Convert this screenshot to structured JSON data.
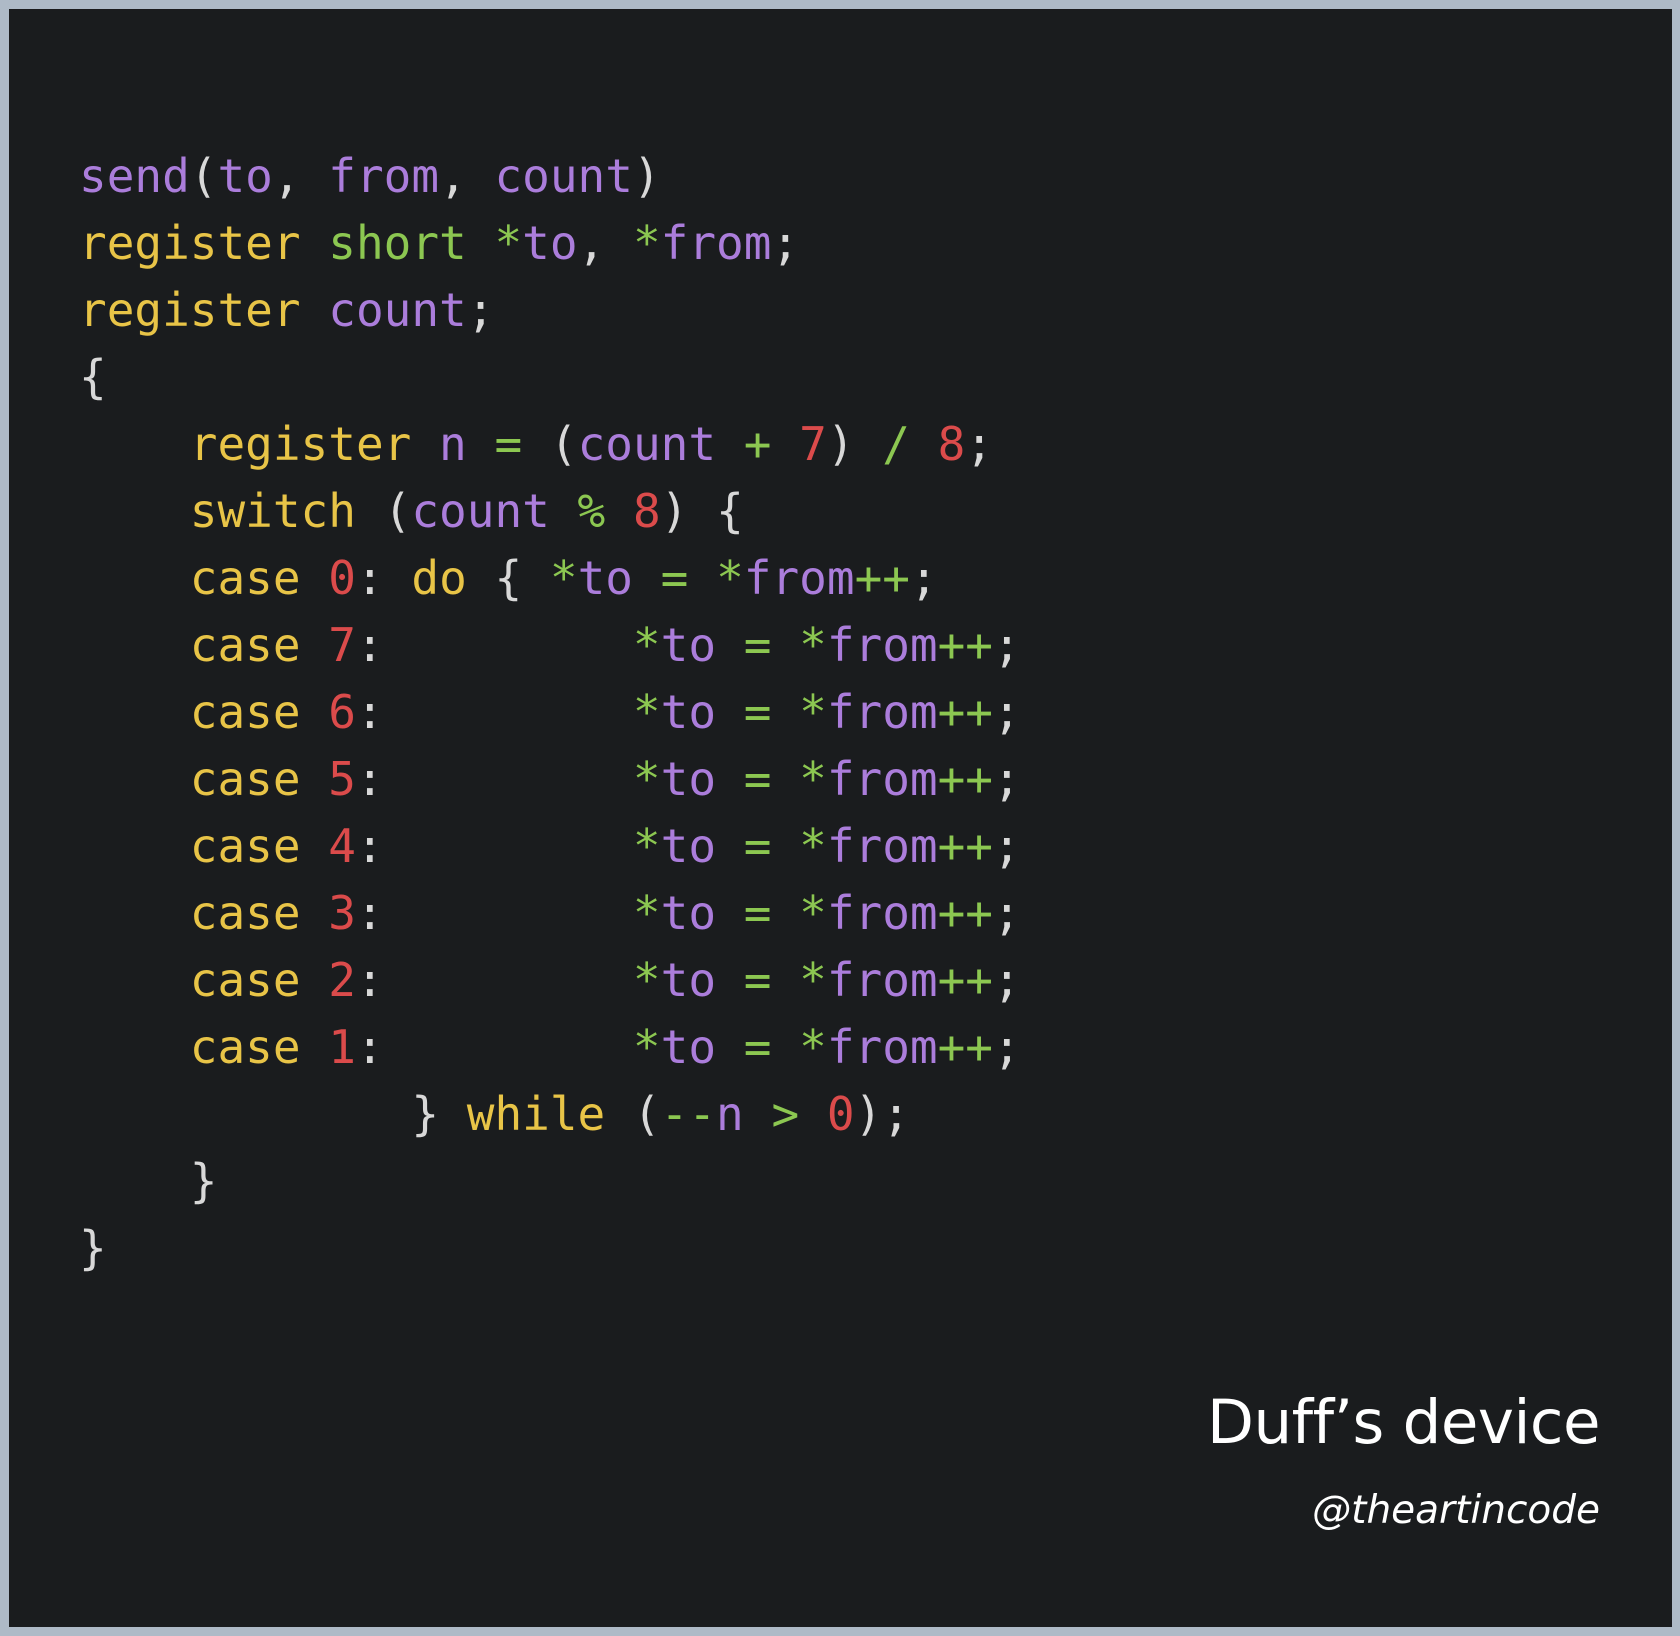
{
  "theme": {
    "border_color": "#aebac7",
    "code_background": "#1a1c1e",
    "keyword_color": "#e8c447",
    "type_color": "#8cc751",
    "identifier_color": "#ab7ddb",
    "operator_color": "#8cc751",
    "number_color": "#db4b4b",
    "punctuation_color": "#d8d8d8",
    "caption_color": "#ffffff"
  },
  "code": {
    "language": "c",
    "lines": [
      [
        {
          "t": "send",
          "c": "id"
        },
        {
          "t": "(",
          "c": "pun"
        },
        {
          "t": "to",
          "c": "id"
        },
        {
          "t": ",",
          "c": "pun"
        },
        {
          "t": " ",
          "c": "pun"
        },
        {
          "t": "from",
          "c": "id"
        },
        {
          "t": ",",
          "c": "pun"
        },
        {
          "t": " ",
          "c": "pun"
        },
        {
          "t": "count",
          "c": "id"
        },
        {
          "t": ")",
          "c": "pun"
        }
      ],
      [
        {
          "t": "register",
          "c": "kw"
        },
        {
          "t": " ",
          "c": "pun"
        },
        {
          "t": "short",
          "c": "typ"
        },
        {
          "t": " ",
          "c": "pun"
        },
        {
          "t": "*",
          "c": "op"
        },
        {
          "t": "to",
          "c": "id"
        },
        {
          "t": ",",
          "c": "pun"
        },
        {
          "t": " ",
          "c": "pun"
        },
        {
          "t": "*",
          "c": "op"
        },
        {
          "t": "from",
          "c": "id"
        },
        {
          "t": ";",
          "c": "pun"
        }
      ],
      [
        {
          "t": "register",
          "c": "kw"
        },
        {
          "t": " ",
          "c": "pun"
        },
        {
          "t": "count",
          "c": "id"
        },
        {
          "t": ";",
          "c": "pun"
        }
      ],
      [
        {
          "t": "{",
          "c": "pun"
        }
      ],
      [
        {
          "t": "    ",
          "c": "pun"
        },
        {
          "t": "register",
          "c": "kw"
        },
        {
          "t": " ",
          "c": "pun"
        },
        {
          "t": "n",
          "c": "id"
        },
        {
          "t": " ",
          "c": "pun"
        },
        {
          "t": "=",
          "c": "op"
        },
        {
          "t": " ",
          "c": "pun"
        },
        {
          "t": "(",
          "c": "pun"
        },
        {
          "t": "count",
          "c": "id"
        },
        {
          "t": " ",
          "c": "pun"
        },
        {
          "t": "+",
          "c": "op"
        },
        {
          "t": " ",
          "c": "pun"
        },
        {
          "t": "7",
          "c": "num"
        },
        {
          "t": ")",
          "c": "pun"
        },
        {
          "t": " ",
          "c": "pun"
        },
        {
          "t": "/",
          "c": "op"
        },
        {
          "t": " ",
          "c": "pun"
        },
        {
          "t": "8",
          "c": "num"
        },
        {
          "t": ";",
          "c": "pun"
        }
      ],
      [
        {
          "t": "    ",
          "c": "pun"
        },
        {
          "t": "switch",
          "c": "kw"
        },
        {
          "t": " ",
          "c": "pun"
        },
        {
          "t": "(",
          "c": "pun"
        },
        {
          "t": "count",
          "c": "id"
        },
        {
          "t": " ",
          "c": "pun"
        },
        {
          "t": "%",
          "c": "op"
        },
        {
          "t": " ",
          "c": "pun"
        },
        {
          "t": "8",
          "c": "num"
        },
        {
          "t": ")",
          "c": "pun"
        },
        {
          "t": " ",
          "c": "pun"
        },
        {
          "t": "{",
          "c": "pun"
        }
      ],
      [
        {
          "t": "    ",
          "c": "pun"
        },
        {
          "t": "case",
          "c": "kw"
        },
        {
          "t": " ",
          "c": "pun"
        },
        {
          "t": "0",
          "c": "num"
        },
        {
          "t": ":",
          "c": "pun"
        },
        {
          "t": " ",
          "c": "pun"
        },
        {
          "t": "do",
          "c": "kw"
        },
        {
          "t": " ",
          "c": "pun"
        },
        {
          "t": "{",
          "c": "pun"
        },
        {
          "t": " ",
          "c": "pun"
        },
        {
          "t": "*",
          "c": "op"
        },
        {
          "t": "to",
          "c": "id"
        },
        {
          "t": " ",
          "c": "pun"
        },
        {
          "t": "=",
          "c": "op"
        },
        {
          "t": " ",
          "c": "pun"
        },
        {
          "t": "*",
          "c": "op"
        },
        {
          "t": "from",
          "c": "id"
        },
        {
          "t": "++",
          "c": "op"
        },
        {
          "t": ";",
          "c": "pun"
        }
      ],
      [
        {
          "t": "    ",
          "c": "pun"
        },
        {
          "t": "case",
          "c": "kw"
        },
        {
          "t": " ",
          "c": "pun"
        },
        {
          "t": "7",
          "c": "num"
        },
        {
          "t": ":",
          "c": "pun"
        },
        {
          "t": "         ",
          "c": "pun"
        },
        {
          "t": "*",
          "c": "op"
        },
        {
          "t": "to",
          "c": "id"
        },
        {
          "t": " ",
          "c": "pun"
        },
        {
          "t": "=",
          "c": "op"
        },
        {
          "t": " ",
          "c": "pun"
        },
        {
          "t": "*",
          "c": "op"
        },
        {
          "t": "from",
          "c": "id"
        },
        {
          "t": "++",
          "c": "op"
        },
        {
          "t": ";",
          "c": "pun"
        }
      ],
      [
        {
          "t": "    ",
          "c": "pun"
        },
        {
          "t": "case",
          "c": "kw"
        },
        {
          "t": " ",
          "c": "pun"
        },
        {
          "t": "6",
          "c": "num"
        },
        {
          "t": ":",
          "c": "pun"
        },
        {
          "t": "         ",
          "c": "pun"
        },
        {
          "t": "*",
          "c": "op"
        },
        {
          "t": "to",
          "c": "id"
        },
        {
          "t": " ",
          "c": "pun"
        },
        {
          "t": "=",
          "c": "op"
        },
        {
          "t": " ",
          "c": "pun"
        },
        {
          "t": "*",
          "c": "op"
        },
        {
          "t": "from",
          "c": "id"
        },
        {
          "t": "++",
          "c": "op"
        },
        {
          "t": ";",
          "c": "pun"
        }
      ],
      [
        {
          "t": "    ",
          "c": "pun"
        },
        {
          "t": "case",
          "c": "kw"
        },
        {
          "t": " ",
          "c": "pun"
        },
        {
          "t": "5",
          "c": "num"
        },
        {
          "t": ":",
          "c": "pun"
        },
        {
          "t": "         ",
          "c": "pun"
        },
        {
          "t": "*",
          "c": "op"
        },
        {
          "t": "to",
          "c": "id"
        },
        {
          "t": " ",
          "c": "pun"
        },
        {
          "t": "=",
          "c": "op"
        },
        {
          "t": " ",
          "c": "pun"
        },
        {
          "t": "*",
          "c": "op"
        },
        {
          "t": "from",
          "c": "id"
        },
        {
          "t": "++",
          "c": "op"
        },
        {
          "t": ";",
          "c": "pun"
        }
      ],
      [
        {
          "t": "    ",
          "c": "pun"
        },
        {
          "t": "case",
          "c": "kw"
        },
        {
          "t": " ",
          "c": "pun"
        },
        {
          "t": "4",
          "c": "num"
        },
        {
          "t": ":",
          "c": "pun"
        },
        {
          "t": "         ",
          "c": "pun"
        },
        {
          "t": "*",
          "c": "op"
        },
        {
          "t": "to",
          "c": "id"
        },
        {
          "t": " ",
          "c": "pun"
        },
        {
          "t": "=",
          "c": "op"
        },
        {
          "t": " ",
          "c": "pun"
        },
        {
          "t": "*",
          "c": "op"
        },
        {
          "t": "from",
          "c": "id"
        },
        {
          "t": "++",
          "c": "op"
        },
        {
          "t": ";",
          "c": "pun"
        }
      ],
      [
        {
          "t": "    ",
          "c": "pun"
        },
        {
          "t": "case",
          "c": "kw"
        },
        {
          "t": " ",
          "c": "pun"
        },
        {
          "t": "3",
          "c": "num"
        },
        {
          "t": ":",
          "c": "pun"
        },
        {
          "t": "         ",
          "c": "pun"
        },
        {
          "t": "*",
          "c": "op"
        },
        {
          "t": "to",
          "c": "id"
        },
        {
          "t": " ",
          "c": "pun"
        },
        {
          "t": "=",
          "c": "op"
        },
        {
          "t": " ",
          "c": "pun"
        },
        {
          "t": "*",
          "c": "op"
        },
        {
          "t": "from",
          "c": "id"
        },
        {
          "t": "++",
          "c": "op"
        },
        {
          "t": ";",
          "c": "pun"
        }
      ],
      [
        {
          "t": "    ",
          "c": "pun"
        },
        {
          "t": "case",
          "c": "kw"
        },
        {
          "t": " ",
          "c": "pun"
        },
        {
          "t": "2",
          "c": "num"
        },
        {
          "t": ":",
          "c": "pun"
        },
        {
          "t": "         ",
          "c": "pun"
        },
        {
          "t": "*",
          "c": "op"
        },
        {
          "t": "to",
          "c": "id"
        },
        {
          "t": " ",
          "c": "pun"
        },
        {
          "t": "=",
          "c": "op"
        },
        {
          "t": " ",
          "c": "pun"
        },
        {
          "t": "*",
          "c": "op"
        },
        {
          "t": "from",
          "c": "id"
        },
        {
          "t": "++",
          "c": "op"
        },
        {
          "t": ";",
          "c": "pun"
        }
      ],
      [
        {
          "t": "    ",
          "c": "pun"
        },
        {
          "t": "case",
          "c": "kw"
        },
        {
          "t": " ",
          "c": "pun"
        },
        {
          "t": "1",
          "c": "num"
        },
        {
          "t": ":",
          "c": "pun"
        },
        {
          "t": "         ",
          "c": "pun"
        },
        {
          "t": "*",
          "c": "op"
        },
        {
          "t": "to",
          "c": "id"
        },
        {
          "t": " ",
          "c": "pun"
        },
        {
          "t": "=",
          "c": "op"
        },
        {
          "t": " ",
          "c": "pun"
        },
        {
          "t": "*",
          "c": "op"
        },
        {
          "t": "from",
          "c": "id"
        },
        {
          "t": "++",
          "c": "op"
        },
        {
          "t": ";",
          "c": "pun"
        }
      ],
      [
        {
          "t": "            ",
          "c": "pun"
        },
        {
          "t": "}",
          "c": "pun"
        },
        {
          "t": " ",
          "c": "pun"
        },
        {
          "t": "while",
          "c": "kw"
        },
        {
          "t": " ",
          "c": "pun"
        },
        {
          "t": "(",
          "c": "pun"
        },
        {
          "t": "--",
          "c": "op"
        },
        {
          "t": "n",
          "c": "id"
        },
        {
          "t": " ",
          "c": "pun"
        },
        {
          "t": ">",
          "c": "op"
        },
        {
          "t": " ",
          "c": "pun"
        },
        {
          "t": "0",
          "c": "num"
        },
        {
          "t": ")",
          "c": "pun"
        },
        {
          "t": ";",
          "c": "pun"
        }
      ],
      [
        {
          "t": "    ",
          "c": "pun"
        },
        {
          "t": "}",
          "c": "pun"
        }
      ],
      [
        {
          "t": "}",
          "c": "pun"
        }
      ]
    ],
    "plain_text": "send(to, from, count)\nregister short *to, *from;\nregister count;\n{\n    register n = (count + 7) / 8;\n    switch (count % 8) {\n    case 0: do { *to = *from++;\n    case 7:         *to = *from++;\n    case 6:         *to = *from++;\n    case 5:         *to = *from++;\n    case 4:         *to = *from++;\n    case 3:         *to = *from++;\n    case 2:         *to = *from++;\n    case 1:         *to = *from++;\n            } while (--n > 0);\n    }\n}"
  },
  "caption": {
    "title": "Duff’s device",
    "handle": "@theartincode"
  }
}
